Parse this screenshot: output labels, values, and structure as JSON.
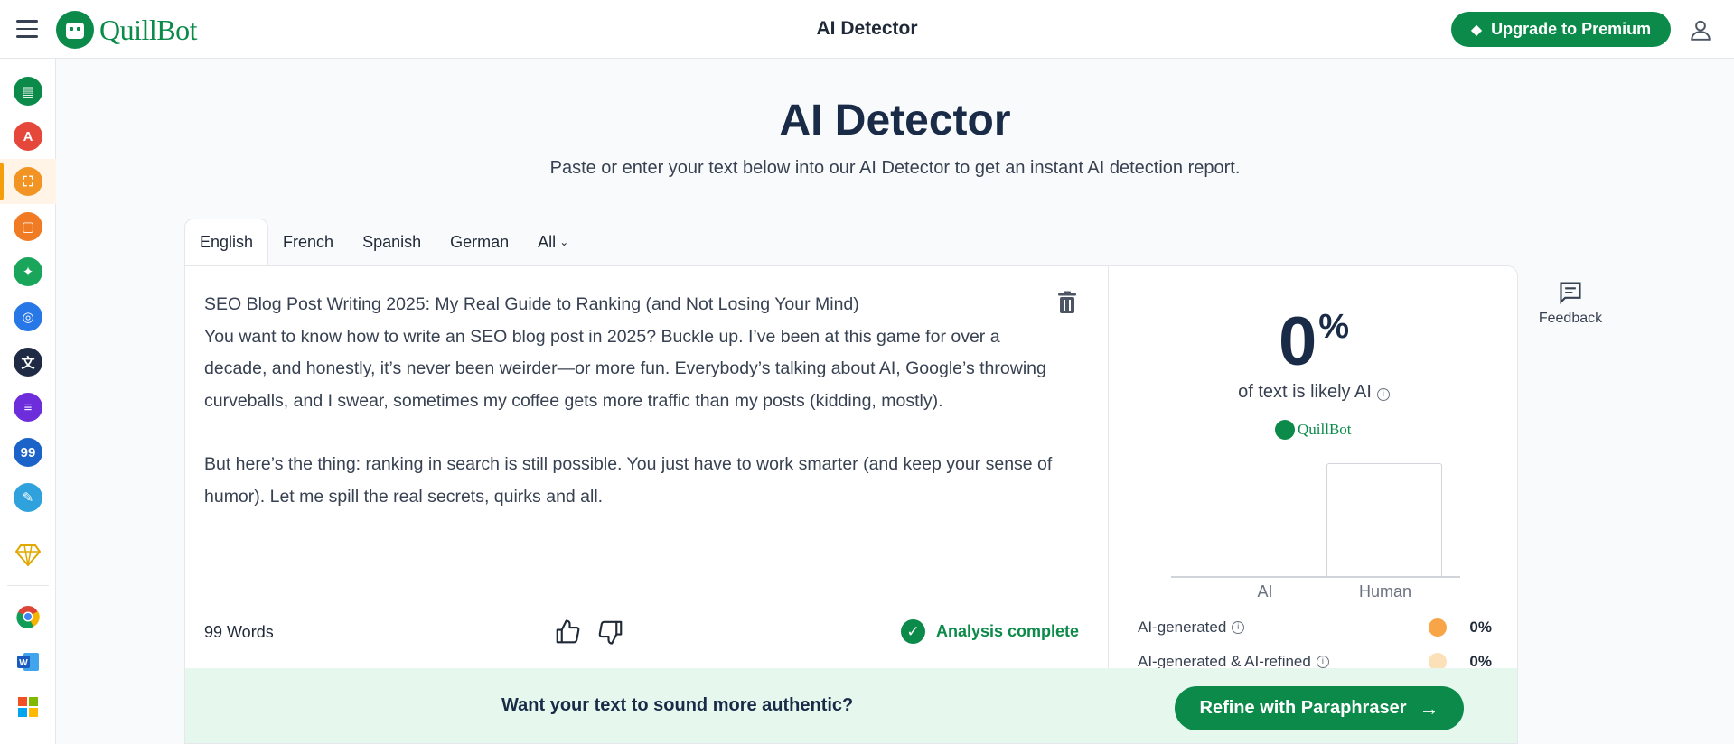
{
  "header": {
    "logo_text": "QuillBot",
    "title": "AI Detector",
    "upgrade_label": "Upgrade to Premium"
  },
  "sidebar": {
    "items": [
      {
        "icon": "paraphraser-icon",
        "color": "#0b8a4a",
        "glyph": "▤"
      },
      {
        "icon": "grammar-checker-icon",
        "color": "#e5483b",
        "glyph": "A"
      },
      {
        "icon": "ai-detector-icon",
        "color": "#f29424",
        "glyph": "⛶",
        "active": true
      },
      {
        "icon": "plagiarism-checker-icon",
        "color": "#f07b24",
        "glyph": "▢"
      },
      {
        "icon": "ai-humanizer-icon",
        "color": "#19a55a",
        "glyph": "✦"
      },
      {
        "icon": "ai-chat-icon",
        "color": "#2777e6",
        "glyph": "◎"
      },
      {
        "icon": "translator-icon",
        "color": "#1f2a44",
        "glyph": "文"
      },
      {
        "icon": "summarizer-icon",
        "color": "#6d2ddb",
        "glyph": "≡"
      },
      {
        "icon": "citation-generator-icon",
        "color": "#1b62c9",
        "glyph": "99"
      },
      {
        "icon": "quillbot-flow-icon",
        "color": "#2fa2dd",
        "glyph": "✎"
      }
    ],
    "extras": [
      {
        "icon": "premium-diamond-icon"
      },
      {
        "icon": "chrome-extension-icon"
      },
      {
        "icon": "word-addin-icon"
      },
      {
        "icon": "windows-app-icon"
      }
    ]
  },
  "main": {
    "heading": "AI Detector",
    "subheading": "Paste or enter your text below into our AI Detector to get an instant AI detection report."
  },
  "tabs": [
    "English",
    "French",
    "Spanish",
    "German",
    "All"
  ],
  "editor": {
    "lines": [
      "SEO Blog Post Writing 2025: My Real Guide to Ranking (and Not Losing Your Mind)",
      "You want to know how to write an SEO blog post in 2025? Buckle up. I’ve been at this game for over a decade, and honestly, it’s never been weirder—or more fun. Everybody’s talking about AI, Google’s throwing curveballs, and I swear, sometimes my coffee gets more traffic than my posts (kidding, mostly).",
      "But here’s the thing: ranking in search is still possible. You just have to work smarter (and keep your sense of humor). Let me spill the real secrets, quirks and all."
    ],
    "word_count": "99 Words",
    "status": "Analysis complete"
  },
  "results": {
    "percent": "0",
    "percent_sign": "%",
    "caption": "of text is likely AI",
    "brand": "QuillBot",
    "bars": [
      {
        "label": "AI",
        "value": 0
      },
      {
        "label": "Human",
        "value": 100
      }
    ],
    "rows": [
      {
        "label": "AI-generated",
        "value": "0%",
        "color": "#f7a547"
      },
      {
        "label": "AI-generated & AI-refined",
        "value": "0%",
        "color": "#fbe0b8"
      }
    ]
  },
  "banner": {
    "question": "Want your text to sound more authentic?",
    "button_label": "Refine with Paraphraser"
  },
  "feedback_label": "Feedback"
}
